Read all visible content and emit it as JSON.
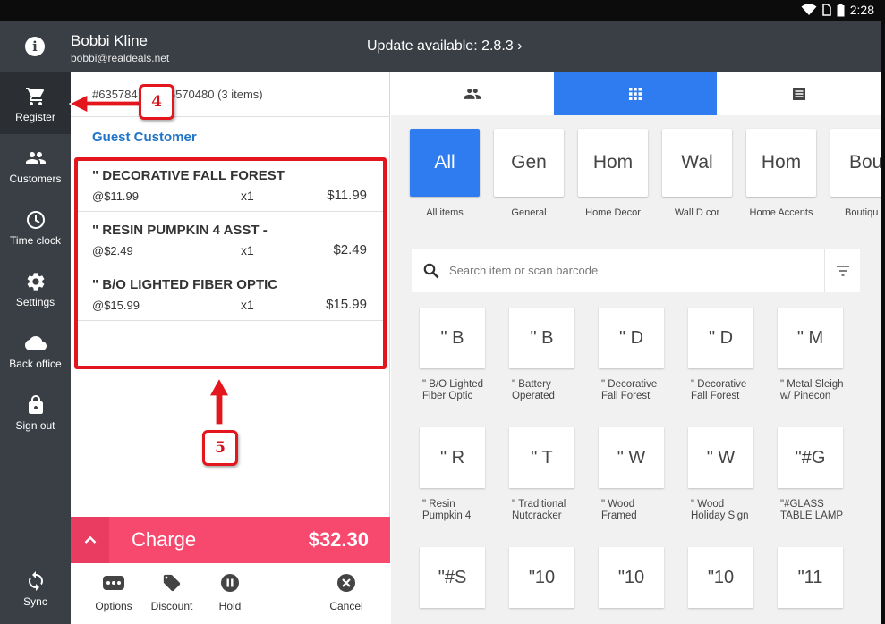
{
  "status_bar": {
    "time": "2:28"
  },
  "header": {
    "user_name": "Bobbi Kline",
    "user_email": "bobbi@realdeals.net",
    "update_text": "Update available: 2.8.3 ›"
  },
  "sidebar": {
    "items": [
      {
        "label": "Register",
        "icon": "cart-icon"
      },
      {
        "label": "Customers",
        "icon": "people-icon"
      },
      {
        "label": "Time clock",
        "icon": "clock-icon"
      },
      {
        "label": "Settings",
        "icon": "gear-icon"
      },
      {
        "label": "Back office",
        "icon": "cloud-icon"
      },
      {
        "label": "Sign out",
        "icon": "lock-icon"
      }
    ],
    "sync_label": "Sync"
  },
  "cart": {
    "order_left": "#635784",
    "order_right": "96570480 (3 items)",
    "customer": "Guest Customer",
    "lines": [
      {
        "title": "\" DECORATIVE FALL FOREST",
        "price": "@$11.99",
        "qty": "x1",
        "total": "$11.99"
      },
      {
        "title": "\" RESIN PUMPKIN  4 ASST -",
        "price": "@$2.49",
        "qty": "x1",
        "total": "$2.49"
      },
      {
        "title": "\" B/O LIGHTED FIBER OPTIC",
        "price": "@$15.99",
        "qty": "x1",
        "total": "$15.99"
      }
    ],
    "charge_label": "Charge",
    "charge_amount": "$32.30",
    "actions": {
      "options": "Options",
      "discount": "Discount",
      "hold": "Hold",
      "cancel": "Cancel"
    }
  },
  "annotations": {
    "callout_4": "4",
    "callout_5": "5"
  },
  "catalog": {
    "categories": [
      {
        "tile": "All",
        "label": "All items"
      },
      {
        "tile": "Gen",
        "label": "General"
      },
      {
        "tile": "Hom",
        "label": "Home Decor"
      },
      {
        "tile": "Wal",
        "label": "Wall D cor"
      },
      {
        "tile": "Hom",
        "label": "Home Accents"
      },
      {
        "tile": "Bou",
        "label": "Boutiqu"
      }
    ],
    "search_placeholder": "Search item or scan barcode",
    "items": [
      {
        "tile": "\" B",
        "line1": "\" B/O Lighted",
        "line2": "Fiber Optic"
      },
      {
        "tile": "\" B",
        "line1": "\" Battery",
        "line2": "Operated"
      },
      {
        "tile": "\" D",
        "line1": "\" Decorative",
        "line2": "Fall Forest"
      },
      {
        "tile": "\" D",
        "line1": "\" Decorative",
        "line2": "Fall Forest"
      },
      {
        "tile": "\" M",
        "line1": "\" Metal Sleigh",
        "line2": "w/ Pinecon"
      },
      {
        "tile": "\" R",
        "line1": "\" Resin",
        "line2": "Pumpkin  4"
      },
      {
        "tile": "\" T",
        "line1": "\" Traditional",
        "line2": "Nutcracker"
      },
      {
        "tile": "\" W",
        "line1": "\" Wood",
        "line2": "Framed"
      },
      {
        "tile": "\" W",
        "line1": "\" Wood",
        "line2": "Holiday Sign"
      },
      {
        "tile": "\"#G",
        "line1": "\"#GLASS",
        "line2": "TABLE LAMP"
      },
      {
        "tile": "\"#S",
        "line1": "",
        "line2": ""
      },
      {
        "tile": "\"10",
        "line1": "",
        "line2": ""
      },
      {
        "tile": "\"10",
        "line1": "",
        "line2": ""
      },
      {
        "tile": "\"10",
        "line1": "",
        "line2": ""
      },
      {
        "tile": "\"11",
        "line1": "",
        "line2": ""
      }
    ]
  },
  "colors": {
    "accent_blue": "#2f7bf0",
    "charge_pink": "#f7496e",
    "sidebar": "#3a3f45",
    "annotation_red": "#e2161c",
    "link_blue": "#1f74c7"
  }
}
